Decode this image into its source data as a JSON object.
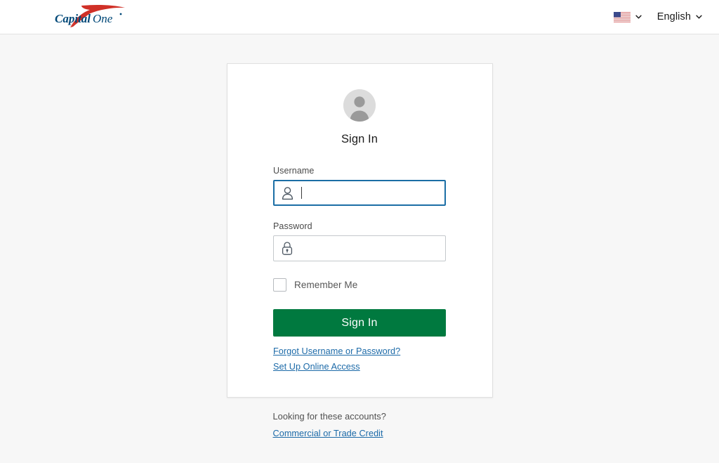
{
  "header": {
    "logo_alt": "Capital One",
    "flag_icon": "us-flag-icon",
    "flag_chevron_icon": "chevron-down-icon",
    "language_label": "English",
    "language_chevron_icon": "chevron-down-icon"
  },
  "card": {
    "avatar_icon": "user-avatar-icon",
    "title": "Sign In",
    "username": {
      "label": "Username",
      "value": "",
      "placeholder": "",
      "icon": "person-outline-icon",
      "focused": true
    },
    "password": {
      "label": "Password",
      "value": "",
      "placeholder": "",
      "icon": "lock-icon",
      "focused": false
    },
    "remember_me": {
      "label": "Remember Me",
      "checked": false
    },
    "submit_label": "Sign In",
    "links": [
      {
        "label": "Forgot Username or Password?"
      },
      {
        "label": "Set Up Online Access"
      }
    ]
  },
  "footer": {
    "prompt": "Looking for these accounts?",
    "link_label": "Commercial or Trade Credit"
  },
  "colors": {
    "brand_green": "#00793f",
    "link_blue": "#1c6aa8",
    "focus_blue": "#1b6ea5",
    "logo_red": "#d03027",
    "logo_navy": "#004878",
    "page_bg": "#f7f7f7"
  }
}
